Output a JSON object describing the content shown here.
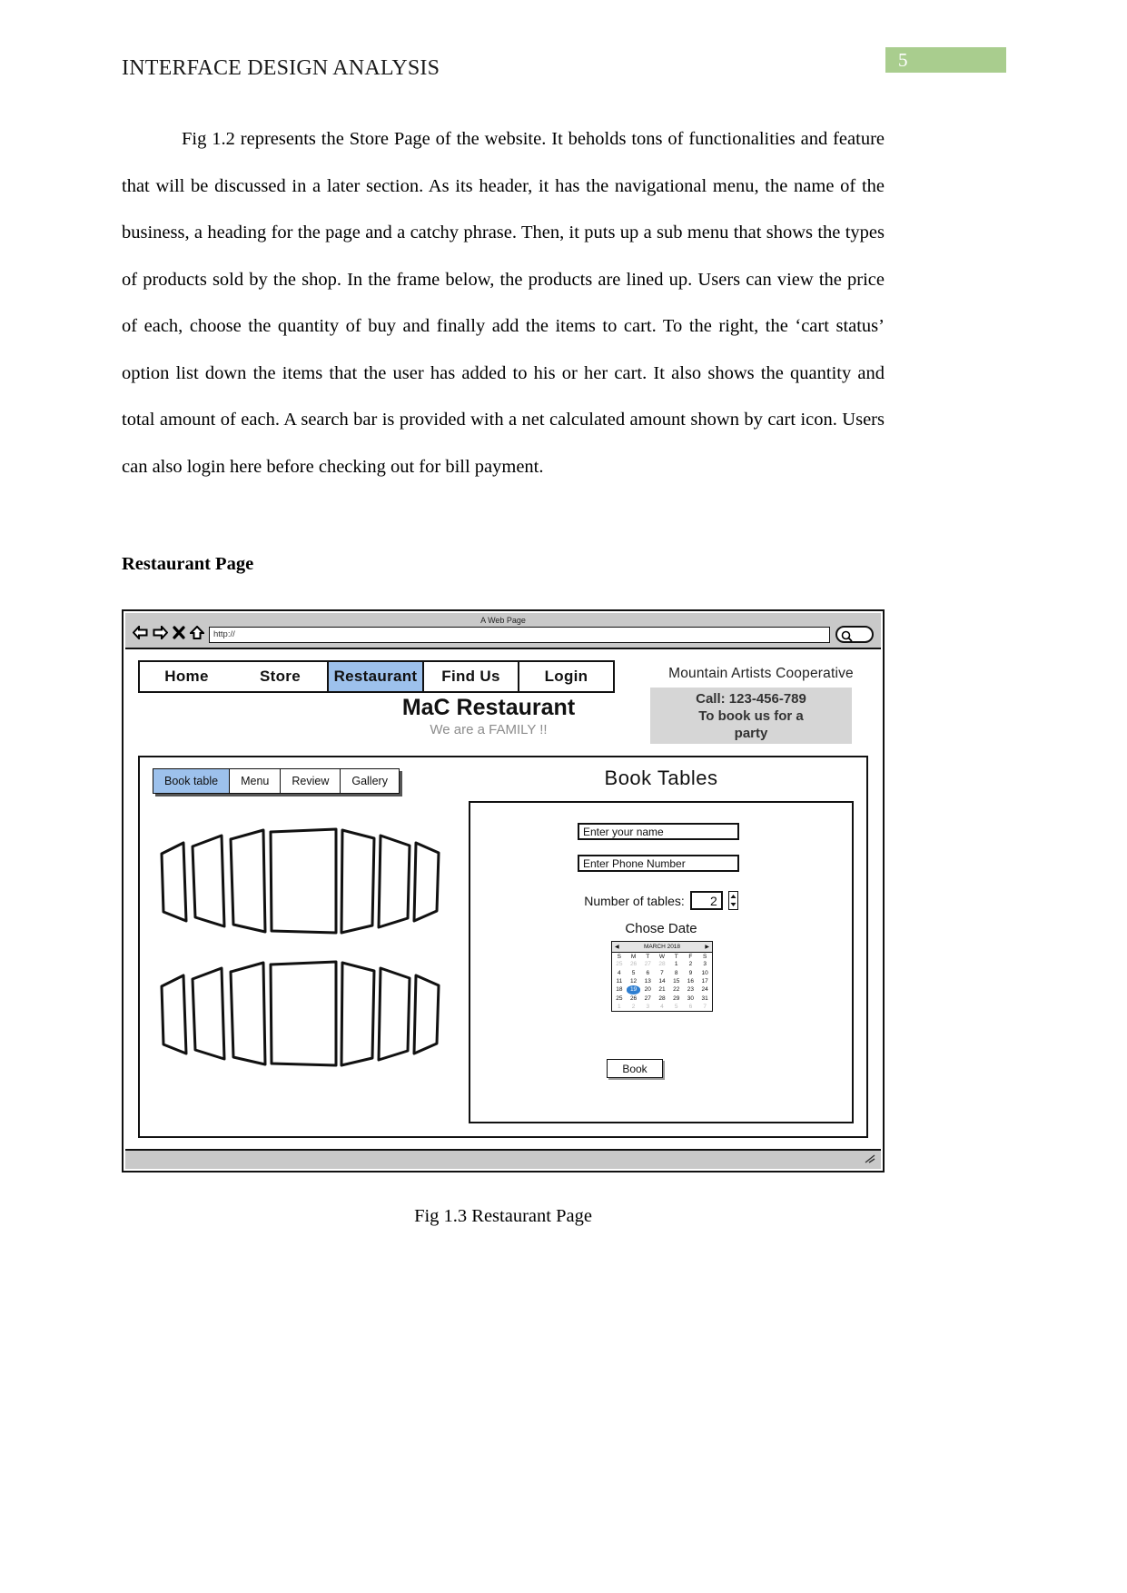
{
  "document": {
    "header_title": "INTERFACE DESIGN ANALYSIS",
    "page_number": "5",
    "page_number_color": "#a9cd8e",
    "paragraph": "Fig 1.2 represents the Store Page of the website. It beholds tons of functionalities and feature that will be discussed in a later section. As its header, it has the navigational menu, the name of the business, a heading for the page and a catchy phrase. Then, it puts up a sub menu that shows the types of products sold by the shop. In the frame below, the products are lined up. Users can view the price of each, choose the quantity of buy and finally add the items to cart.  To the right, the ‘cart status’ option list down the items that the user has added to his or her cart. It also shows the quantity and total amount of each. A search bar is provided with a net calculated amount shown by cart icon. Users can also login here before checking out for bill payment.",
    "section_heading": "Restaurant Page",
    "figure_caption": "Fig 1.3 Restaurant Page"
  },
  "browser": {
    "window_title": "A Web Page",
    "url_value": "http://",
    "icons": {
      "back": "back-arrow-icon",
      "forward": "forward-arrow-icon",
      "stop": "stop-x-icon",
      "home": "home-icon",
      "search": "magnifier-icon"
    }
  },
  "site": {
    "nav": [
      {
        "label": "Home",
        "selected": false
      },
      {
        "label": "Store",
        "selected": false
      },
      {
        "label": "Restaurant",
        "selected": true
      },
      {
        "label": "Find Us",
        "selected": false
      },
      {
        "label": "Login",
        "selected": false
      }
    ],
    "nav_highlight_color": "#9dc1ec",
    "org_name": "Mountain Artists Cooperative",
    "call_box": {
      "line1": "Call: 123-456-789",
      "line2": "To book us for a",
      "line3": "party",
      "background": "#d6d6d6"
    },
    "brand_title": "MaC Restaurant",
    "brand_subtitle": "We are a FAMILY !!"
  },
  "restaurant": {
    "subtabs": [
      {
        "label": "Book table",
        "selected": true
      },
      {
        "label": "Menu",
        "selected": false
      },
      {
        "label": "Review",
        "selected": false
      },
      {
        "label": "Gallery",
        "selected": false
      }
    ],
    "panel_heading": "Book Tables",
    "form": {
      "name_placeholder": "Enter your name",
      "name_value": "Enter your name",
      "phone_placeholder": "Enter Phone Number",
      "phone_value": "Enter Phone Number",
      "tables_label": "Number of tables:",
      "tables_value": "2",
      "date_label": "Chose Date",
      "submit_label": "Book"
    },
    "calendar": {
      "month_title": "MARCH 2018",
      "prev_arrow": "◀",
      "next_arrow": "▶",
      "dow": [
        "S",
        "M",
        "T",
        "W",
        "T",
        "F",
        "S"
      ],
      "selected_day": "19",
      "selected_color": "#2f7fd1",
      "weeks": [
        [
          {
            "d": "25",
            "mute": true
          },
          {
            "d": "26",
            "mute": true
          },
          {
            "d": "27",
            "mute": true
          },
          {
            "d": "28",
            "mute": true
          },
          {
            "d": "1"
          },
          {
            "d": "2"
          },
          {
            "d": "3"
          }
        ],
        [
          {
            "d": "4"
          },
          {
            "d": "5"
          },
          {
            "d": "6"
          },
          {
            "d": "7"
          },
          {
            "d": "8"
          },
          {
            "d": "9"
          },
          {
            "d": "10"
          }
        ],
        [
          {
            "d": "11"
          },
          {
            "d": "12"
          },
          {
            "d": "13"
          },
          {
            "d": "14"
          },
          {
            "d": "15"
          },
          {
            "d": "16"
          },
          {
            "d": "17"
          }
        ],
        [
          {
            "d": "18"
          },
          {
            "d": "19",
            "sel": true
          },
          {
            "d": "20"
          },
          {
            "d": "21"
          },
          {
            "d": "22"
          },
          {
            "d": "23"
          },
          {
            "d": "24"
          }
        ],
        [
          {
            "d": "25"
          },
          {
            "d": "26"
          },
          {
            "d": "27"
          },
          {
            "d": "28"
          },
          {
            "d": "29"
          },
          {
            "d": "30"
          },
          {
            "d": "31"
          }
        ],
        [
          {
            "d": "1",
            "mute": true
          },
          {
            "d": "2",
            "mute": true
          },
          {
            "d": "3",
            "mute": true
          },
          {
            "d": "4",
            "mute": true
          },
          {
            "d": "5",
            "mute": true
          },
          {
            "d": "6",
            "mute": true
          },
          {
            "d": "7",
            "mute": true
          }
        ]
      ]
    }
  }
}
